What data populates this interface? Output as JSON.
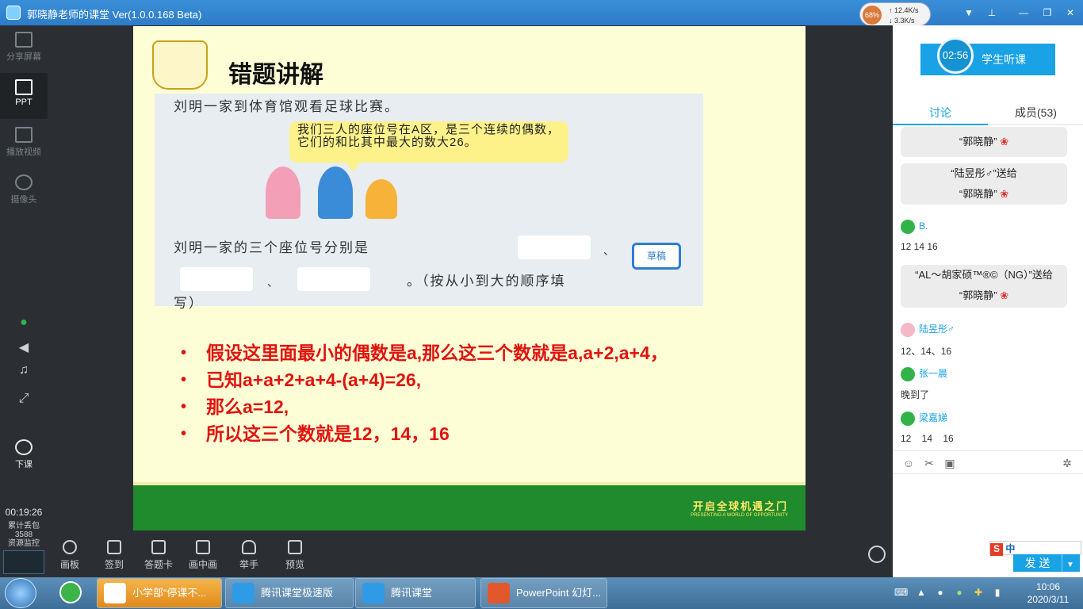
{
  "window": {
    "title": "郭晓静老师的课堂 Ver(1.0.0.168 Beta)"
  },
  "net": {
    "cpu": "68%",
    "up": "12.4K/s",
    "down": "3.3K/s"
  },
  "sidebar": {
    "items": [
      {
        "label": "分享屏幕",
        "icon": "share-screen-icon"
      },
      {
        "label": "PPT",
        "icon": "ppt-icon"
      },
      {
        "label": "播放视频",
        "icon": "play-video-icon"
      },
      {
        "label": "摄像头",
        "icon": "camera-icon"
      }
    ],
    "end_class": "下课",
    "elapsed": "00:19:26",
    "bag_label": "累计丢包",
    "bag_value": "3588",
    "monitor_label": "资源监控"
  },
  "slide": {
    "title": "错题讲解",
    "problem_line1": "刘明一家到体育馆观看足球比赛。",
    "bubble": "我们三人的座位号在A区，是三个连续的偶数，它们的和比其中最大的数大26。",
    "problem_line2": "刘明一家的三个座位号分别是",
    "separator": "、",
    "problem_line3": "。（按从小到大的顺序填",
    "problem_line4": "写）",
    "draft_label": "草稿",
    "bullets": [
      "假设这里面最小的偶数是a,那么这三个数就是a,a+2,a+4，",
      "已知a+a+2+a+4-(a+4)=26,",
      "那么a=12,",
      "所以这三个数就是12，14，16"
    ],
    "footer_cn": "开启全球机遇之门",
    "footer_en": "PRESENTING A WORLD OF OPPORTUNITY"
  },
  "toolbar": {
    "items": [
      {
        "label": "画板",
        "icon": "palette-icon"
      },
      {
        "label": "签到",
        "icon": "checkin-icon"
      },
      {
        "label": "答题卡",
        "icon": "answer-card-icon"
      },
      {
        "label": "画中画",
        "icon": "pip-icon"
      },
      {
        "label": "举手",
        "icon": "raise-hand-icon"
      },
      {
        "label": "预览",
        "icon": "preview-icon"
      }
    ]
  },
  "right": {
    "timer": "02:56",
    "listen_btn": "学生听课",
    "tabs": [
      "讨论",
      "成员(53)"
    ],
    "chat": [
      {
        "type": "gift",
        "line1": "",
        "line2": "“郭晓静”"
      },
      {
        "type": "gift",
        "line1": "“陆昱彤♂”送给",
        "line2": "“郭晓静”"
      },
      {
        "type": "msg",
        "name": "B.",
        "text": "12 14 16"
      },
      {
        "type": "gift",
        "line1": "“AL～胡家硕™®©（NG）”送给",
        "line2": "“郭晓静”"
      },
      {
        "type": "msg",
        "name": "陆昱彤♂",
        "text": "12、14、16"
      },
      {
        "type": "msg",
        "name": "张一晨",
        "text": "晚到了"
      },
      {
        "type": "msg",
        "name": "梁嘉娣",
        "text": "12    14    16"
      }
    ],
    "send_label": "发 送",
    "ime_label": "中"
  },
  "taskbar": {
    "tasks": [
      {
        "label": "小学部“停课不...",
        "active": true
      },
      {
        "label": "腾讯课堂极速版",
        "active": false
      },
      {
        "label": "腾讯课堂",
        "active": false
      },
      {
        "label": "PowerPoint 幻灯...",
        "active": false
      }
    ],
    "time": "10:06",
    "date": "2020/3/11"
  }
}
